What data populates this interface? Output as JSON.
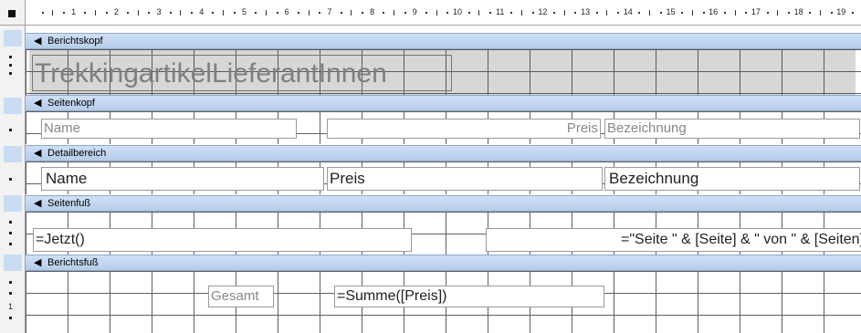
{
  "ruler": {
    "marks": [
      "1",
      "2",
      "3",
      "4",
      "5",
      "6",
      "7",
      "8",
      "9",
      "10",
      "11",
      "12",
      "13",
      "14",
      "15",
      "16",
      "17",
      "18",
      "19"
    ]
  },
  "sections": {
    "berichtskopf": {
      "label": "Berichtskopf",
      "title": "TrekkingartikelLieferantInnen"
    },
    "seitenkopf": {
      "label": "Seitenkopf",
      "name_label": "Name",
      "preis_label": "Preis",
      "bezeichnung_label": "Bezeichnung"
    },
    "detailbereich": {
      "label": "Detailbereich",
      "name_field": "Name",
      "preis_field": "Preis",
      "bezeichnung_field": "Bezeichnung"
    },
    "seitenfuss": {
      "label": "Seitenfuß",
      "date_field": "=Jetzt()",
      "page_field": "=\"Seite \" & [Seite] & \" von \" & [Seiten]"
    },
    "berichtsfuss": {
      "label": "Berichtsfuß",
      "gesamt_label": "Gesamt",
      "summe_field": "=Summe([Preis])"
    }
  },
  "vruler": {
    "one": "1"
  }
}
